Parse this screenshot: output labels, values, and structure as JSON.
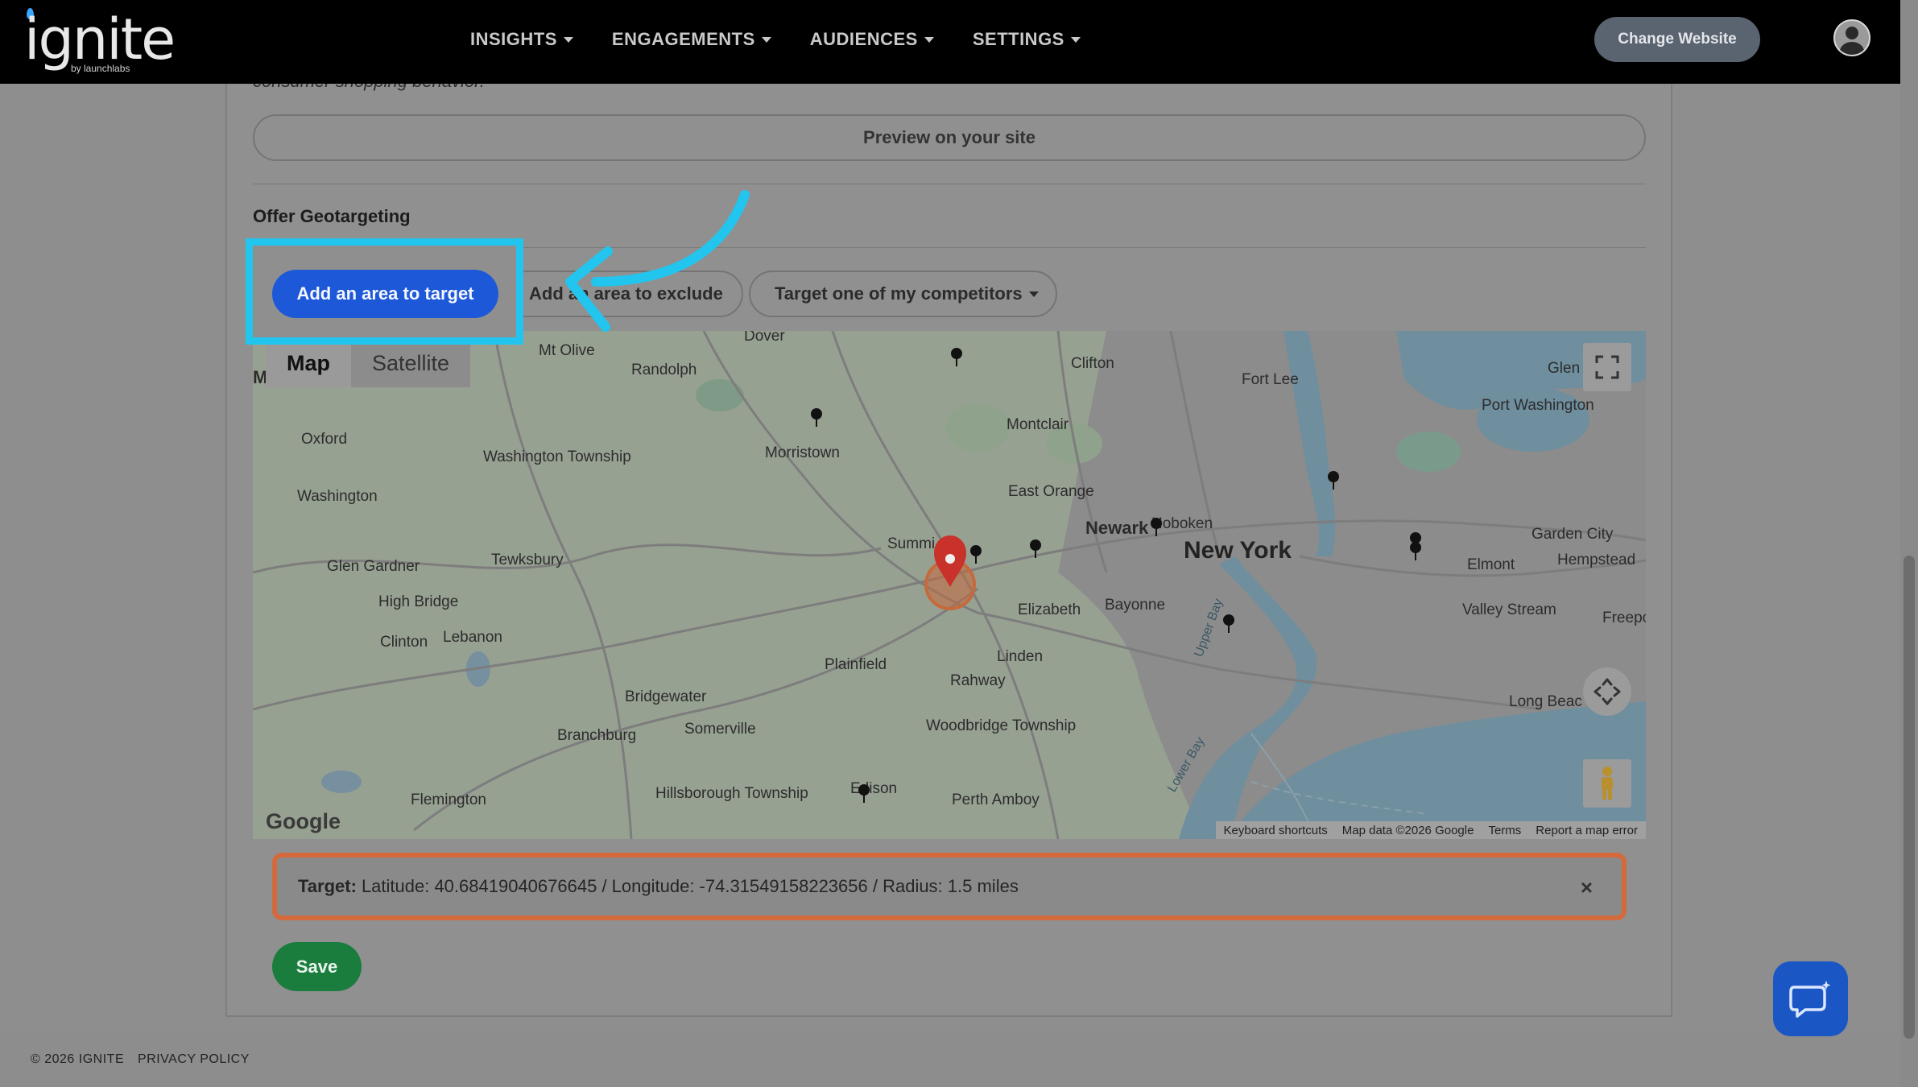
{
  "header": {
    "logo_text": "ignite",
    "logo_sub": "by launchlabs",
    "nav": [
      "INSIGHTS",
      "ENGAGEMENTS",
      "AUDIENCES",
      "SETTINGS"
    ],
    "change_website": "Change Website"
  },
  "content": {
    "cut_text": "consumer shopping behavior.",
    "preview_button": "Preview on your site",
    "section_title": "Offer Geotargeting",
    "add_target_button": "Add an area to target",
    "add_exclude_button": "Add an area to exclude",
    "competitor_button": "Target one of my competitors"
  },
  "map": {
    "type_map": "Map",
    "type_satellite": "Satellite",
    "google": "Google",
    "attribution": [
      "Keyboard shortcuts",
      "Map data ©2026 Google",
      "Terms",
      "Report a map error"
    ],
    "labels": {
      "new_york": "New York",
      "newark": "Newark",
      "morristown": "Morristown",
      "montclair": "Montclair",
      "east_orange": "East Orange",
      "elizabeth": "Elizabeth",
      "bayonne": "Bayonne",
      "hoboken": "Hoboken",
      "plainfield": "Plainfield",
      "linden": "Linden",
      "rahway": "Rahway",
      "woodbridge": "Woodbridge Township",
      "perth_amboy": "Perth Amboy",
      "edison": "Edison",
      "somerville": "Somerville",
      "bridgewater": "Bridgewater",
      "branchburg": "Branchburg",
      "hillsborough": "Hillsborough Township",
      "flemington": "Flemington",
      "clinton": "Clinton",
      "lebanon": "Lebanon",
      "high_bridge": "High Bridge",
      "glen_gardner": "Glen Gardner",
      "tewksbury": "Tewksbury",
      "washington": "Washington",
      "washington_twp": "Washington Township",
      "oxford": "Oxford",
      "mt_olive": "Mt Olive",
      "randolph": "Randolph",
      "dover": "Dover",
      "clifton": "Clifton",
      "fort_lee": "Fort Lee",
      "port_washington": "Port Washington",
      "garden_city": "Garden City",
      "hempstead": "Hempstead",
      "elmont": "Elmont",
      "valley_stream": "Valley Stream",
      "long_beach": "Long Beac",
      "glen": "Glen",
      "freepo": "Freepo",
      "summit": "Summi",
      "upper_bay": "Upper Bay",
      "lower_bay": "Lower Bay"
    }
  },
  "target": {
    "label": "Target:",
    "text": "Latitude: 40.68419040676645 / Longitude: -74.31549158223656 / Radius: 1.5 miles",
    "close": "×"
  },
  "save_button": "Save",
  "footer": {
    "copyright": "© 2026 IGNITE",
    "privacy": "PRIVACY POLICY"
  }
}
